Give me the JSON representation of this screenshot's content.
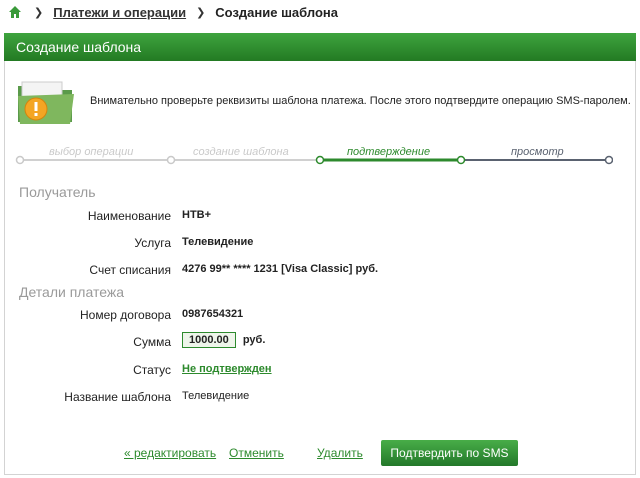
{
  "breadcrumbs": {
    "home_icon": "home-icon",
    "items": [
      {
        "label": "Платежи и операции",
        "link": true
      },
      {
        "label": "Создание шаблона",
        "link": false
      }
    ]
  },
  "panel": {
    "title": "Создание шаблона",
    "notice": "Внимательно проверьте реквизиты шаблона платежа. После этого подтвердите операцию SMS-паролем."
  },
  "steps": [
    {
      "label": "выбор операции",
      "state": "done"
    },
    {
      "label": "создание шаблона",
      "state": "done"
    },
    {
      "label": "подтверждение",
      "state": "active"
    },
    {
      "label": "просмотр",
      "state": "next"
    }
  ],
  "recipient": {
    "title": "Получатель",
    "name_label": "Наименование",
    "name_value": "НТВ+",
    "service_label": "Услуга",
    "service_value": "Телевидение",
    "account_label": "Счет списания",
    "account_value": "4276 99** **** 1231  [Visa Classic]",
    "account_currency": "руб."
  },
  "payment": {
    "title": "Детали платежа",
    "contract_label": "Номер договора",
    "contract_value": "0987654321",
    "sum_label": "Сумма",
    "sum_value": "1000.00",
    "sum_currency": "руб.",
    "status_label": "Статус",
    "status_value": "Не подтвержден",
    "template_label": "Название шаблона",
    "template_value": "Телевидение"
  },
  "actions": {
    "edit": "« редактировать",
    "cancel": "Отменить",
    "delete": "Удалить",
    "confirm": "Подтвердить по SMS"
  },
  "colors": {
    "accent": "#2d8a2d",
    "header_green": "#2f8f2f",
    "step_done": "#c9c9c9",
    "step_next": "#5a6270"
  }
}
